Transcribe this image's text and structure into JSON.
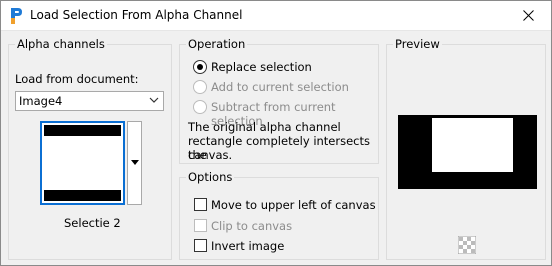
{
  "window": {
    "title": "Load Selection From Alpha Channel"
  },
  "alpha_channels": {
    "group_label": "Alpha channels",
    "load_from_label": "Load from document:",
    "document_value": "Image4",
    "channel_name": "Selectie 2"
  },
  "operation": {
    "group_label": "Operation",
    "options": [
      {
        "label": "Replace selection",
        "selected": true,
        "enabled": true
      },
      {
        "label": "Add to current selection",
        "selected": false,
        "enabled": false
      },
      {
        "label": "Subtract from current selection",
        "selected": false,
        "enabled": false
      }
    ],
    "info_line1": "The original alpha channel",
    "info_line2": "rectangle completely intersects the",
    "info_line3": "canvas."
  },
  "options": {
    "group_label": "Options",
    "items": [
      {
        "label": "Move to upper left of canvas",
        "checked": false,
        "enabled": true
      },
      {
        "label": "Clip to canvas",
        "checked": false,
        "enabled": false
      },
      {
        "label": "Invert image",
        "checked": false,
        "enabled": true
      }
    ]
  },
  "preview": {
    "group_label": "Preview"
  },
  "colors": {
    "accent": "#0b6fd3",
    "disabled": "#8c8c8c"
  },
  "icons": {
    "app": "paintshop-pro-icon",
    "close": "close-icon",
    "dropdown": "chevron-down-icon",
    "thumb_dropdown": "triangle-down-icon",
    "transparency": "checkerboard-icon"
  }
}
